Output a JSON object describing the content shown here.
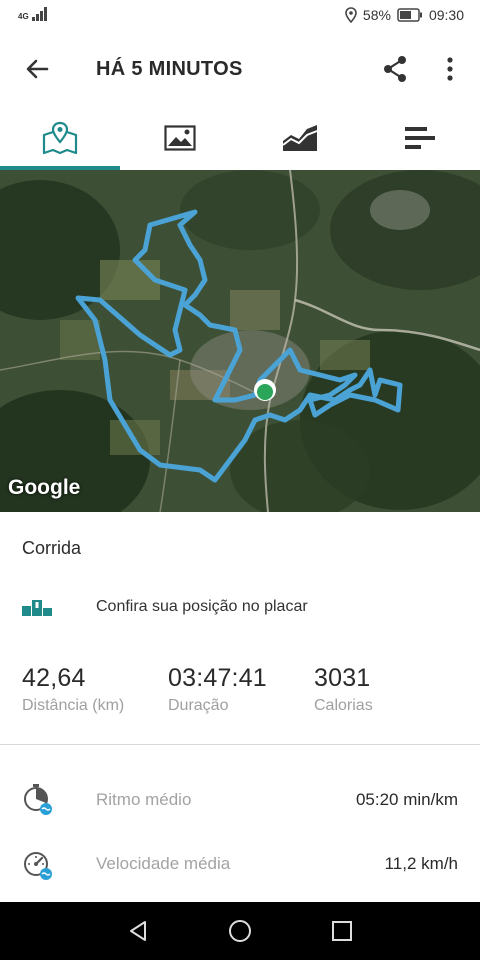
{
  "status_bar": {
    "network": "4G",
    "battery": "58%",
    "time": "09:30"
  },
  "app_bar": {
    "title": "HÁ 5 MINUTOS"
  },
  "tabs": [
    {
      "icon": "map-icon",
      "selected": true
    },
    {
      "icon": "image-icon",
      "selected": false
    },
    {
      "icon": "chart-icon",
      "selected": false
    },
    {
      "icon": "splits-icon",
      "selected": false
    }
  ],
  "map": {
    "attribution": "Google",
    "route_color": "#4aa3d4"
  },
  "activity": {
    "type": "Corrida",
    "leaderboard_text": "Confira sua posição no placar"
  },
  "stats": [
    {
      "value": "42,64",
      "label": "Distância (km)"
    },
    {
      "value": "03:47:41",
      "label": "Duração"
    },
    {
      "value": "3031",
      "label": "Calorias"
    }
  ],
  "metrics": [
    {
      "label": "Ritmo médio",
      "value": "05:20 min/km",
      "icon": "pace-icon"
    },
    {
      "label": "Velocidade média",
      "value": "11,2 km/h",
      "icon": "speed-icon"
    }
  ],
  "colors": {
    "accent": "#1f8a8a",
    "route": "#4aa3d4",
    "end_marker": "#2aa55a"
  }
}
